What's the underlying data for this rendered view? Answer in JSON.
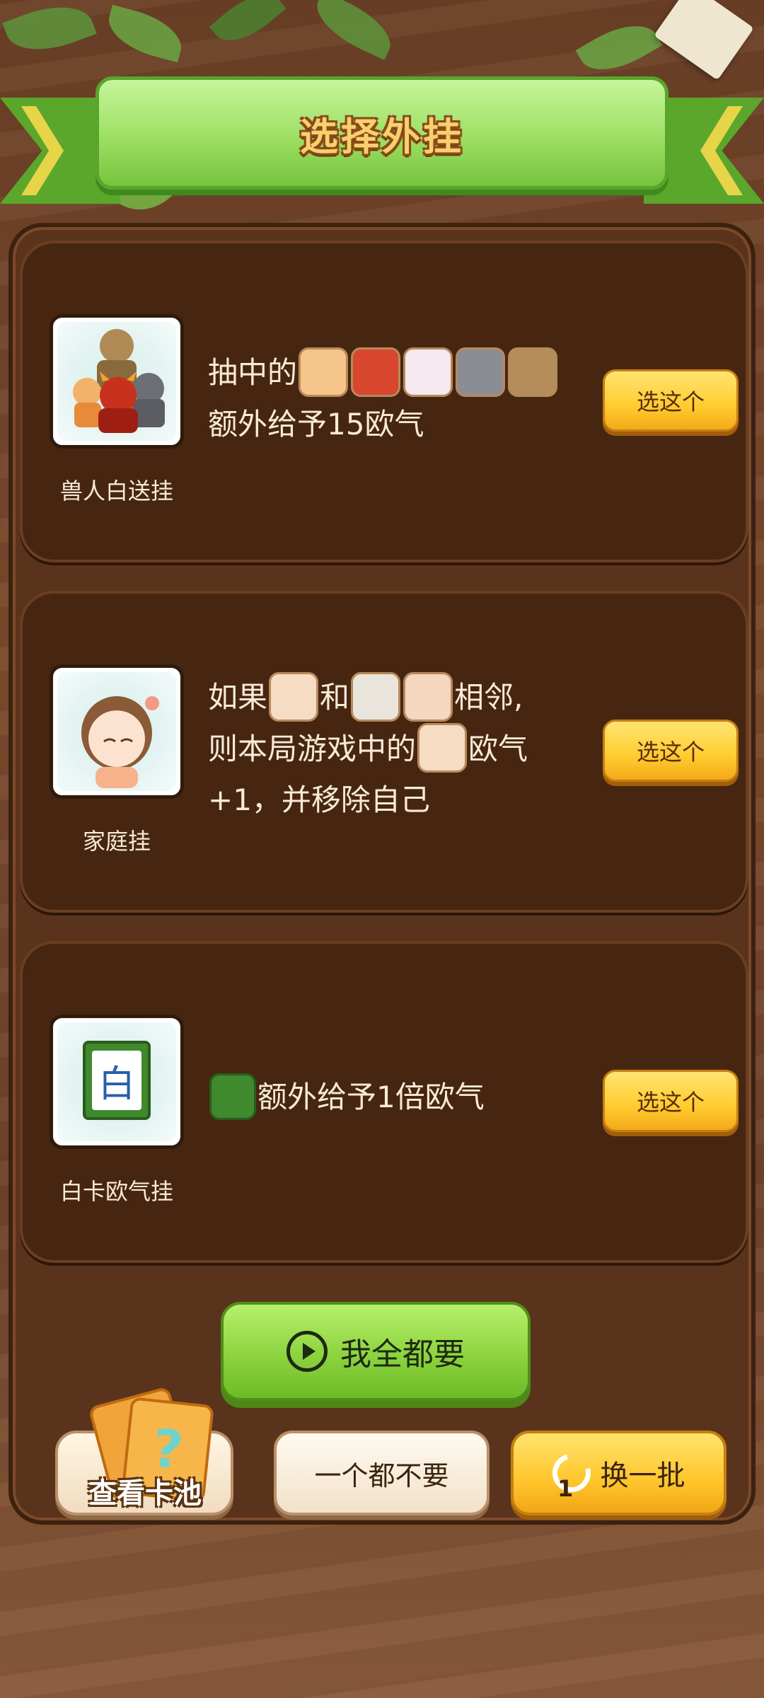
{
  "header": {
    "title": "选择外挂"
  },
  "cards": [
    {
      "name": "兽人白送挂",
      "icon": "orc-monsters-icon",
      "desc_line1_prefix": "抽中的",
      "desc_line2": "额外给予15欧气",
      "button": "选这个"
    },
    {
      "name": "家庭挂",
      "icon": "girl-avatar-icon",
      "desc_line1_a": "如果",
      "desc_line1_b": "和",
      "desc_line1_c": "相邻,",
      "desc_line2_prefix": "则本局游戏中的",
      "desc_line2_suffix": "欧气",
      "desc_line3": "+1，并移除自己",
      "button": "选这个"
    },
    {
      "name": "白卡欧气挂",
      "icon": "white-card-icon",
      "card_glyph": "白",
      "desc": "额外给予1倍欧气",
      "button": "选这个"
    }
  ],
  "actions": {
    "take_all": "我全都要",
    "view_pool": "查看卡池",
    "pool_glyph": "?",
    "take_none": "一个都不要",
    "refresh": "换一批",
    "refresh_count": "1"
  }
}
